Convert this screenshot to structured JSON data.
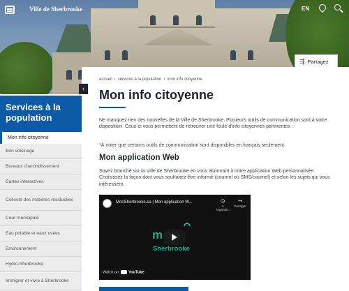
{
  "header": {
    "site_name": "Ville de Sherbrooke",
    "lang": "EN"
  },
  "share": {
    "label": "Partagez"
  },
  "sidebar": {
    "title": "Services à la population",
    "active_item": "Mon info citoyenne",
    "items": [
      {
        "label": "Bon voisinage"
      },
      {
        "label": "Bureaux d'arrondissement"
      },
      {
        "label": "Cartes interactives"
      },
      {
        "label": "Collecte des matières résiduelles"
      },
      {
        "label": "Cour municipale"
      },
      {
        "label": "Eau potable et eaux usées"
      },
      {
        "label": "Environnement"
      },
      {
        "label": "Hydro-Sherbrooke"
      },
      {
        "label": "Immigrer et vivre à Sherbrooke"
      }
    ]
  },
  "breadcrumb": [
    "accueil",
    "services à la population",
    "mon info citoyenne"
  ],
  "main": {
    "title": "Mon info citoyenne",
    "intro": "Ne manquez rien des nouvelles de la Ville de Sherbrooke. Plusieurs outils de communication sont à votre disposition. Ceux-ci vous permettent de retrouver une foule d'info citoyennes pertinentes :",
    "note": "*À noter que certains outils de communication sont disponibles en français seulement.",
    "section_title": "Mon application Web",
    "section_body": "Soyez branché sur la Ville de Sherbrooke en vous abonnant à notre application Web personnalisée. Choisissez la façon dont vous souhaitez être informé (courriel ou SMS/courriel) et selon les sujets qui vous intéressent."
  },
  "video": {
    "title": "MonSherbrooke.ca | Mon application W...",
    "watch_later": "À regarder...",
    "share": "Partager",
    "logo_top": "mon",
    "logo_bottom": "Sherbrooke",
    "watch_on": "Watch on",
    "youtube": "YouTube"
  }
}
